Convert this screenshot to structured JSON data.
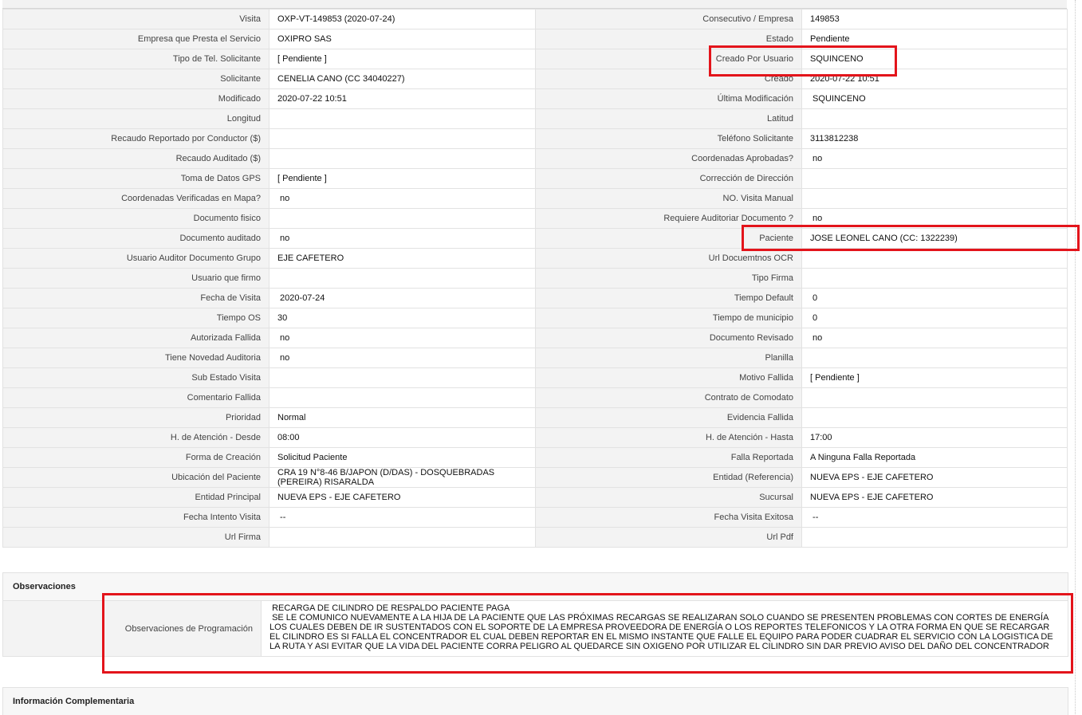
{
  "rows": [
    [
      {
        "label": "Visita",
        "value": "OXP-VT-149853 (2020-07-24)"
      },
      {
        "label": "Consecutivo / Empresa",
        "value": "149853"
      }
    ],
    [
      {
        "label": "Empresa que Presta el Servicio",
        "value": "OXIPRO SAS"
      },
      {
        "label": "Estado",
        "value": "Pendiente"
      }
    ],
    [
      {
        "label": "Tipo de Tel. Solicitante",
        "value": "[ Pendiente ]"
      },
      {
        "label": "Creado Por Usuario",
        "value": "SQUINCENO"
      }
    ],
    [
      {
        "label": "Solicitante",
        "value": "CENELIA CANO (CC 34040227)"
      },
      {
        "label": "Creado",
        "value": "2020-07-22 10:51"
      }
    ],
    [
      {
        "label": "Modificado",
        "value": "2020-07-22 10:51"
      },
      {
        "label": "Última Modificación",
        "value": " SQUINCENO"
      }
    ],
    [
      {
        "label": "Longitud",
        "value": ""
      },
      {
        "label": "Latitud",
        "value": ""
      }
    ],
    [
      {
        "label": "Recaudo Reportado por Conductor ($)",
        "value": ""
      },
      {
        "label": "Teléfono Solicitante",
        "value": "3113812238"
      }
    ],
    [
      {
        "label": "Recaudo Auditado ($)",
        "value": ""
      },
      {
        "label": "Coordenadas Aprobadas?",
        "value": " no"
      }
    ],
    [
      {
        "label": "Toma de Datos GPS",
        "value": "[ Pendiente ]"
      },
      {
        "label": "Corrección de Dirección",
        "value": ""
      }
    ],
    [
      {
        "label": "Coordenadas Verificadas en Mapa?",
        "value": " no"
      },
      {
        "label": "NO. Visita Manual",
        "value": ""
      }
    ],
    [
      {
        "label": "Documento fisico",
        "value": ""
      },
      {
        "label": "Requiere Auditoriar Documento ?",
        "value": " no"
      }
    ],
    [
      {
        "label": "Documento auditado",
        "value": " no"
      },
      {
        "label": "Paciente",
        "value": "JOSE LEONEL CANO (CC: 1322239)"
      }
    ],
    [
      {
        "label": "Usuario Auditor Documento Grupo",
        "value": "EJE CAFETERO"
      },
      {
        "label": "Url Docuemtnos OCR",
        "value": ""
      }
    ],
    [
      {
        "label": "Usuario que firmo",
        "value": ""
      },
      {
        "label": "Tipo Firma",
        "value": ""
      }
    ],
    [
      {
        "label": "Fecha de Visita",
        "value": " 2020-07-24"
      },
      {
        "label": "Tiempo Default",
        "value": " 0"
      }
    ],
    [
      {
        "label": "Tiempo OS",
        "value": "30"
      },
      {
        "label": "Tiempo de municipio",
        "value": " 0"
      }
    ],
    [
      {
        "label": "Autorizada Fallida",
        "value": " no"
      },
      {
        "label": "Documento Revisado",
        "value": " no"
      }
    ],
    [
      {
        "label": "Tiene Novedad Auditoria",
        "value": " no"
      },
      {
        "label": "Planilla",
        "value": ""
      }
    ],
    [
      {
        "label": "Sub Estado Visita",
        "value": ""
      },
      {
        "label": "Motivo Fallida",
        "value": "[ Pendiente ]"
      }
    ],
    [
      {
        "label": "Comentario Fallida",
        "value": ""
      },
      {
        "label": "Contrato de Comodato",
        "value": ""
      }
    ],
    [
      {
        "label": "Prioridad",
        "value": "Normal"
      },
      {
        "label": "Evidencia Fallida",
        "value": ""
      }
    ],
    [
      {
        "label": "H. de Atención - Desde",
        "value": "08:00"
      },
      {
        "label": "H. de Atención - Hasta",
        "value": "17:00"
      }
    ],
    [
      {
        "label": "Forma de Creación",
        "value": "Solicitud Paciente"
      },
      {
        "label": "Falla Reportada",
        "value": "A Ninguna Falla Reportada"
      }
    ],
    [
      {
        "label": "Ubicación del Paciente",
        "value": "CRA 19 N°8-46 B/JAPON (D/DAS) - DOSQUEBRADAS (PEREIRA) RISARALDA"
      },
      {
        "label": "Entidad (Referencia)",
        "value": "NUEVA EPS - EJE CAFETERO"
      }
    ],
    [
      {
        "label": "Entidad Principal",
        "value": "NUEVA EPS - EJE CAFETERO"
      },
      {
        "label": "Sucursal",
        "value": "NUEVA EPS - EJE CAFETERO"
      }
    ],
    [
      {
        "label": "Fecha Intento Visita",
        "value": " --"
      },
      {
        "label": "Fecha Visita Exitosa",
        "value": " --"
      }
    ],
    [
      {
        "label": "Url Firma",
        "value": ""
      },
      {
        "label": "Url Pdf",
        "value": ""
      }
    ]
  ],
  "observaciones": {
    "title": "Observaciones",
    "label": "Observaciones de Programación",
    "text": " RECARGA DE CILINDRO DE RESPALDO PACIENTE PAGA\n SE LE COMUNICO NUEVAMENTE A LA HIJA DE LA PACIENTE QUE LAS PRÓXIMAS RECARGAS SE REALIZARAN SOLO CUANDO SE PRESENTEN PROBLEMAS CON CORTES DE ENERGÍA LOS CUALES DEBEN DE IR SUSTENTADOS CON EL SOPORTE DE LA EMPRESA PROVEEDORA DE ENERGÍA O LOS REPORTES TELEFONICOS Y LA OTRA FORMA EN QUE SE RECARGAR EL CILINDRO ES SI FALLA EL CONCENTRADOR EL CUAL DEBEN REPORTAR EN EL MISMO INSTANTE QUE FALLE EL EQUIPO PARA PODER CUADRAR EL SERVICIO CON LA LOGISTICA DE LA RUTA Y ASI EVITAR QUE LA VIDA DEL PACIENTE CORRA PELIGRO AL QUEDARCE SIN OXIGENO POR UTILIZAR EL CILINDRO SIN DAR PREVIO AVISO DEL DAÑO DEL CONCENTRADOR"
  },
  "informacion": {
    "title": "Información Complementaria"
  },
  "colors": {
    "highlight": "#e3141b",
    "label_bg": "#f3f3f3",
    "border": "#e2e2e2"
  }
}
